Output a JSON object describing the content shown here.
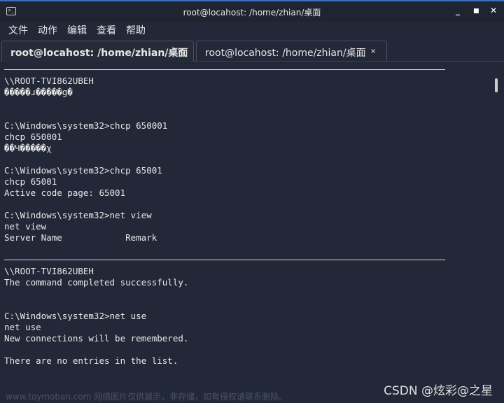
{
  "window": {
    "title": "root@locahost: /home/zhian/桌面",
    "controls": {
      "minimize": "_",
      "maximize": "■",
      "close": "✕"
    }
  },
  "menu": [
    "文件",
    "动作",
    "编辑",
    "查看",
    "帮助"
  ],
  "tabs": [
    {
      "label": "root@locahost: /home/zhian/桌面",
      "close": "×"
    },
    {
      "label": "root@locahost: /home/zhian/桌面",
      "close": "×"
    }
  ],
  "terminal": {
    "lines": [
      {
        "type": "hr"
      },
      {
        "text": "\\\\ROOT-TVI862UBEH"
      },
      {
        "text": "�����ɹ�����g�"
      },
      {
        "text": ""
      },
      {
        "text": ""
      },
      {
        "text": "C:\\Windows\\system32>chcp 650001"
      },
      {
        "text": "chcp 650001"
      },
      {
        "text": "��Ч�����χ"
      },
      {
        "text": ""
      },
      {
        "text": "C:\\Windows\\system32>chcp 65001"
      },
      {
        "text": "chcp 65001"
      },
      {
        "text": "Active code page: 65001"
      },
      {
        "text": ""
      },
      {
        "text": "C:\\Windows\\system32>net view"
      },
      {
        "text": "net view"
      },
      {
        "text": "Server Name            Remark"
      },
      {
        "text": ""
      },
      {
        "type": "hr"
      },
      {
        "text": "\\\\ROOT-TVI862UBEH"
      },
      {
        "text": "The command completed successfully."
      },
      {
        "text": ""
      },
      {
        "text": ""
      },
      {
        "text": "C:\\Windows\\system32>net use"
      },
      {
        "text": "net use"
      },
      {
        "text": "New connections will be remembered."
      },
      {
        "text": ""
      },
      {
        "text": "There are no entries in the list."
      }
    ]
  },
  "watermark": {
    "csdn": "CSDN @炫彩@之星",
    "site": "www.toymoban.com 网络图片仅供展示，非存储，如有侵权请联系删除。"
  }
}
